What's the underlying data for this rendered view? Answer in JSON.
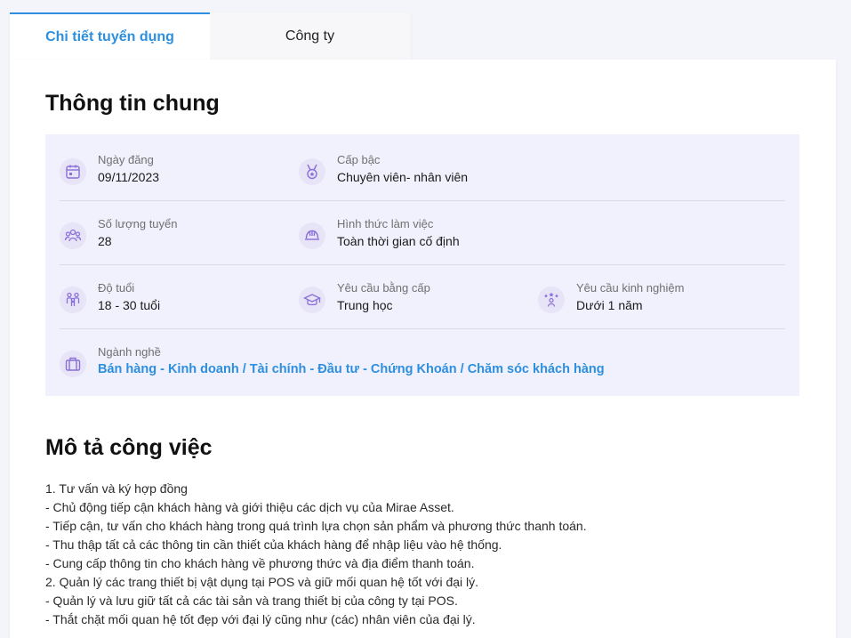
{
  "tabs": [
    {
      "label": "Chi tiết tuyển dụng",
      "active": true
    },
    {
      "label": "Công ty",
      "active": false
    }
  ],
  "general": {
    "title": "Thông tin chung",
    "post_date": {
      "label": "Ngày đăng",
      "value": "09/11/2023",
      "icon": "calendar-icon"
    },
    "level": {
      "label": "Cấp bậc",
      "value": "Chuyên viên- nhân viên",
      "icon": "medal-icon"
    },
    "quantity": {
      "label": "Số lượng tuyển",
      "value": "28",
      "icon": "people-icon"
    },
    "work_type": {
      "label": "Hình thức làm việc",
      "value": "Toàn thời gian cố định",
      "icon": "helmet-icon"
    },
    "age": {
      "label": "Độ tuổi",
      "value": "18 - 30 tuổi",
      "icon": "family-icon"
    },
    "degree": {
      "label": "Yêu cầu bằng cấp",
      "value": "Trung học",
      "icon": "graduation-cap-icon"
    },
    "experience": {
      "label": "Yêu cầu kinh nghiệm",
      "value": "Dưới 1 năm",
      "icon": "person-stars-icon"
    },
    "industry": {
      "label": "Ngành nghề",
      "value": "Bán hàng - Kinh doanh / Tài chính - Đầu tư - Chứng Khoán / Chăm sóc khách hàng",
      "icon": "briefcase-icon"
    }
  },
  "description": {
    "title": "Mô tả công việc",
    "lines": [
      "1. Tư vấn và ký hợp đồng",
      "- Chủ động tiếp cận khách hàng và giới thiệu các dịch vụ của Mirae Asset.",
      "- Tiếp cận, tư vấn cho khách hàng trong quá trình lựa chọn sản phẩm và phương thức thanh toán.",
      "- Thu thập tất cả các thông tin cần thiết của khách hàng để nhập liệu vào hệ thống.",
      "- Cung cấp thông tin cho khách hàng về phương thức và địa điểm thanh toán.",
      "2. Quản lý các trang thiết bị vật dụng tại POS và giữ mối quan hệ tốt với đại lý.",
      "- Quản lý và lưu giữ tất cả các tài sản và trang thiết bị của công ty tại POS.",
      "- Thắt chặt mối quan hệ tốt đẹp với đại lý cũng như (các) nhân viên của đại lý."
    ]
  },
  "colors": {
    "accent": "#2d8fde",
    "info_bg": "#f1f1fd",
    "icon_color": "#8a6fd8"
  }
}
